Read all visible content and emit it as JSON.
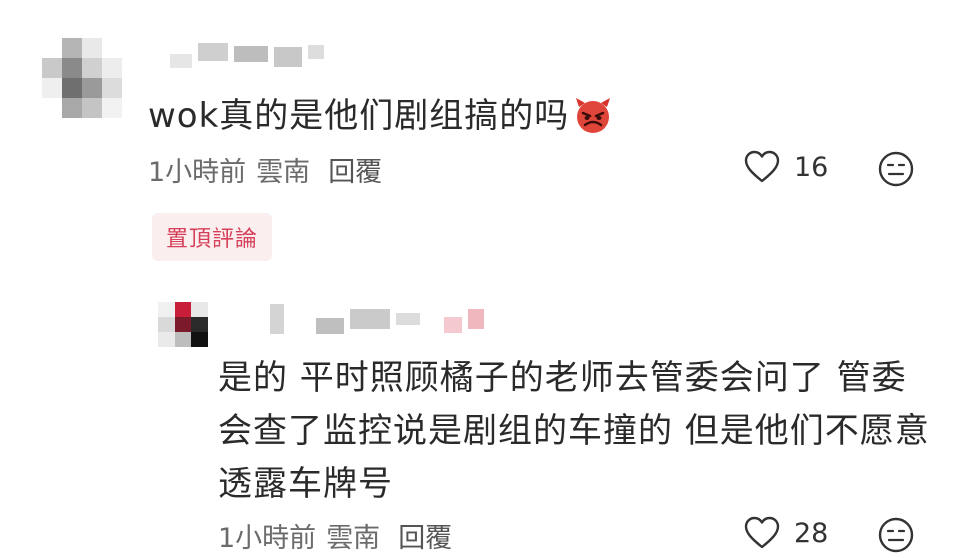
{
  "comments": [
    {
      "text": "wok真的是他们剧组搞的吗",
      "emoji": "angry-devil-emoji",
      "time": "1小時前",
      "location": "雲南",
      "reply_label": "回覆",
      "likes": "16",
      "pinned_label": "置頂評論"
    },
    {
      "text": "是的 平时照顾橘子的老师去管委会问了 管委会查了监控说是剧组的车撞的 但是他们不愿意透露车牌号",
      "time": "1小時前",
      "location": "雲南",
      "reply_label": "回覆",
      "likes": "28"
    }
  ],
  "icons": {
    "like": "heart-outline-icon",
    "reaction": "neutral-face-icon"
  },
  "colors": {
    "pinned_text": "#d6405a",
    "pinned_bg": "#fbeeef",
    "meta_text": "#6b6b6b"
  }
}
